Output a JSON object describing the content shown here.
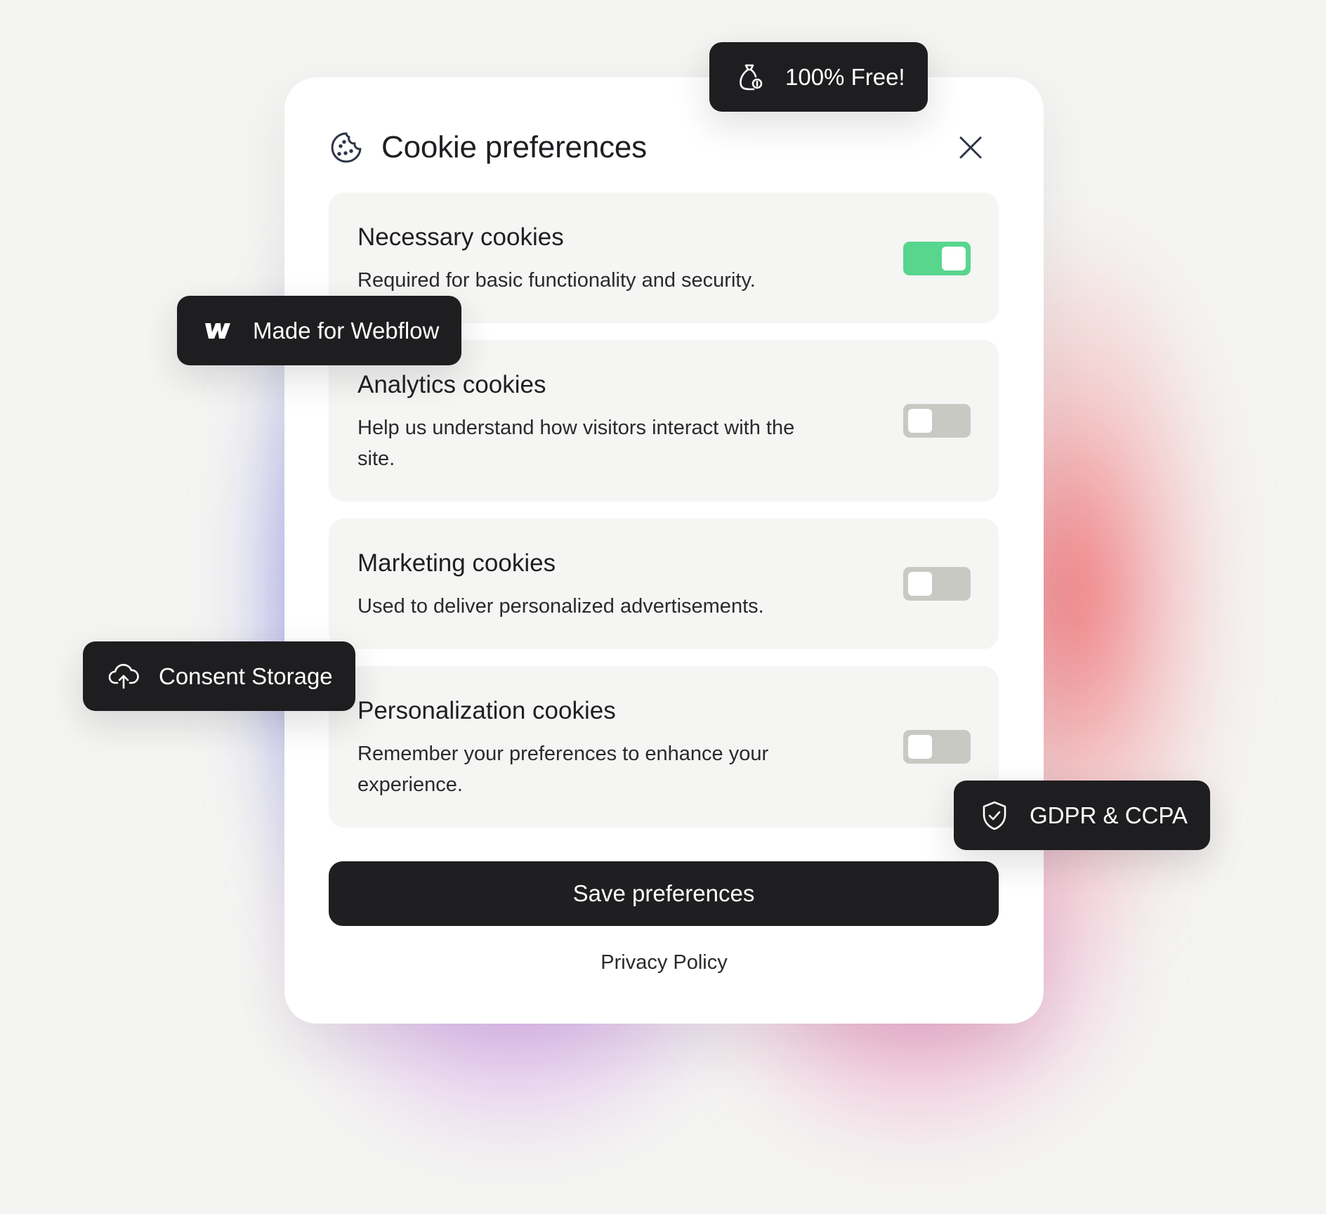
{
  "modal": {
    "title": "Cookie preferences",
    "cookie_icon": "cookie-icon",
    "close_icon": "close-icon"
  },
  "categories": [
    {
      "title": "Necessary cookies",
      "description": "Required for basic functionality and security.",
      "enabled": true
    },
    {
      "title": "Analytics cookies",
      "description": "Help us understand how visitors interact with the site.",
      "enabled": false
    },
    {
      "title": "Marketing cookies",
      "description": "Used to deliver personalized advertisements.",
      "enabled": false
    },
    {
      "title": "Personalization cookies",
      "description": "Remember your preferences to enhance your experience.",
      "enabled": false
    }
  ],
  "actions": {
    "save_label": "Save preferences",
    "privacy_label": "Privacy Policy"
  },
  "badges": {
    "free": {
      "label": "100% Free!",
      "icon": "money-bag-icon"
    },
    "webflow": {
      "label": "Made for Webflow",
      "icon": "webflow-logo-icon"
    },
    "storage": {
      "label": "Consent Storage",
      "icon": "cloud-upload-icon"
    },
    "gdpr": {
      "label": "GDPR & CCPA",
      "icon": "shield-check-icon"
    }
  },
  "colors": {
    "toggle_on": "#58d68d",
    "toggle_off": "#c9c9c4",
    "dark": "#1e1e20",
    "card_bg": "#f5f5f3"
  }
}
